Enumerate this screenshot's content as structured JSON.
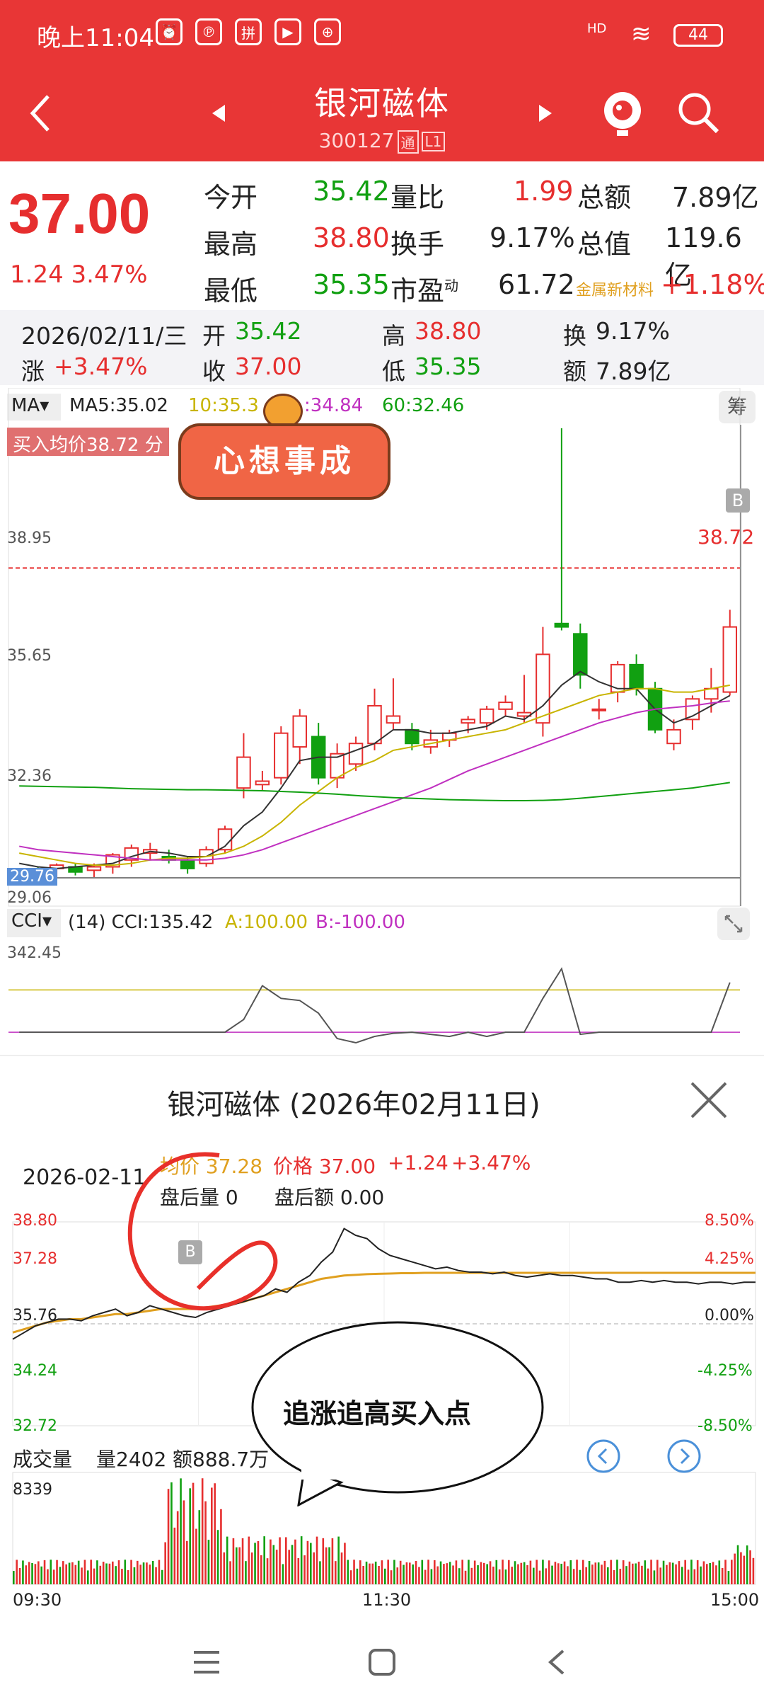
{
  "status": {
    "time": "晚上11:04",
    "network": "HD",
    "battery": "44"
  },
  "header": {
    "title": "银河磁体",
    "code": "300127",
    "tag_tong": "通",
    "tag_l1": "L1"
  },
  "quote": {
    "price": "37.00",
    "change": "1.24",
    "change_pct": "3.47%",
    "open_label": "今开",
    "open": "35.42",
    "high_label": "最高",
    "high": "38.80",
    "low_label": "最低",
    "low": "35.35",
    "volratio_label": "量比",
    "volratio": "1.99",
    "turnover_label": "换手",
    "turnover": "9.17%",
    "pe_label": "市盈",
    "pe_sup": "动",
    "pe": "61.72",
    "amount_label": "总额",
    "amount": "7.89亿",
    "mktcap_label": "总值",
    "mktcap": "119.6亿",
    "sector_name": "金属新材料",
    "sector_pct": "+1.18%"
  },
  "day": {
    "date": "2026/02/11/三",
    "open_label": "开",
    "open": "35.42",
    "high_label": "高",
    "high": "38.80",
    "turn_label": "换",
    "turn": "9.17%",
    "chg_label": "涨",
    "chg": "+3.47%",
    "close_label": "收",
    "close": "37.00",
    "low_label": "低",
    "low": "35.35",
    "amt_label": "额",
    "amt": "7.89亿"
  },
  "kline": {
    "ma_label": "MA",
    "ma5": "MA5:35.02",
    "ma10": "10:35.3",
    "ma20": ":34.84",
    "ma60": "60:32.46",
    "chip_btn": "筹",
    "buy_avg": "买入均价38.72 分",
    "sticker": "心想事成",
    "ylabels": [
      "38.95",
      "35.65",
      "32.36",
      "29.76",
      "29.06"
    ],
    "price_tag": "38.72",
    "b_marker": "B",
    "cci_label": "CCI",
    "cci_text": "(14) CCI:135.42",
    "cci_a": "A:100.00",
    "cci_b": "B:-100.00",
    "cci_top": "342.45"
  },
  "popup": {
    "title": "银河磁体 (2026年02月11日)",
    "date": "2026-02-11",
    "avg_price": "均价 37.28",
    "price": "价格 37.00",
    "chg": "+1.24",
    "chg_pct": "+3.47%",
    "after_vol": "盘后量  0",
    "after_amt": "盘后额  0.00",
    "left_axis": [
      "38.80",
      "37.28",
      "35.76",
      "34.24",
      "32.72"
    ],
    "right_axis": [
      "8.50%",
      "4.25%",
      "0.00%",
      "-4.25%",
      "-8.50%"
    ],
    "vol_label": "成交量",
    "vol": "量2402",
    "amt": "额888.7万",
    "vol_max": "8339",
    "times": [
      "09:30",
      "11:30",
      "15:00"
    ],
    "comment": "追涨追高买入点",
    "b_marker": "B"
  },
  "kline_chart_data": {
    "type": "candlestick",
    "candles": [
      [
        29.7,
        29.95,
        29.5,
        29.9
      ],
      [
        29.9,
        30.0,
        29.7,
        29.85
      ],
      [
        29.95,
        30.1,
        29.7,
        30.05
      ],
      [
        30.0,
        30.1,
        29.75,
        29.85
      ],
      [
        29.9,
        30.1,
        29.7,
        30.0
      ],
      [
        30.0,
        30.4,
        29.8,
        30.35
      ],
      [
        30.2,
        30.65,
        30.0,
        30.55
      ],
      [
        30.4,
        30.7,
        30.2,
        30.5
      ],
      [
        30.3,
        30.5,
        30.1,
        30.2
      ],
      [
        30.2,
        30.3,
        29.8,
        29.95
      ],
      [
        30.1,
        30.6,
        30.0,
        30.5
      ],
      [
        30.5,
        31.2,
        30.4,
        31.1
      ],
      [
        32.3,
        33.9,
        32.0,
        33.2
      ],
      [
        32.4,
        32.8,
        32.2,
        32.5
      ],
      [
        32.6,
        34.1,
        32.4,
        33.9
      ],
      [
        33.5,
        34.6,
        33.0,
        34.4
      ],
      [
        33.8,
        34.2,
        32.4,
        32.6
      ],
      [
        32.6,
        33.6,
        32.3,
        33.3
      ],
      [
        33.0,
        33.8,
        32.8,
        33.6
      ],
      [
        33.6,
        35.2,
        33.4,
        34.7
      ],
      [
        34.2,
        35.5,
        34.0,
        34.4
      ],
      [
        34.0,
        34.2,
        33.4,
        33.6
      ],
      [
        33.5,
        34.0,
        33.3,
        33.7
      ],
      [
        33.7,
        34.0,
        33.5,
        33.9
      ],
      [
        34.2,
        34.4,
        33.9,
        34.3
      ],
      [
        34.2,
        34.7,
        34.0,
        34.6
      ],
      [
        34.6,
        35.0,
        34.4,
        34.8
      ],
      [
        34.4,
        35.6,
        34.2,
        34.5
      ],
      [
        34.2,
        37.0,
        33.8,
        36.2
      ],
      [
        37.1,
        42.8,
        36.9,
        37.0
      ],
      [
        36.8,
        37.1,
        35.2,
        35.6
      ],
      [
        34.6,
        34.9,
        34.3,
        34.6
      ],
      [
        35.1,
        36.0,
        34.8,
        35.9
      ],
      [
        35.9,
        36.2,
        35.0,
        35.2
      ],
      [
        35.2,
        35.4,
        33.9,
        34.0
      ],
      [
        33.6,
        34.3,
        33.4,
        34.0
      ],
      [
        34.3,
        35.0,
        34.0,
        34.9
      ],
      [
        34.9,
        35.8,
        34.5,
        35.2
      ],
      [
        35.1,
        37.5,
        35.0,
        37.0
      ]
    ],
    "ma5": [
      30.1,
      30.0,
      29.95,
      30.0,
      30.05,
      30.1,
      30.3,
      30.45,
      30.4,
      30.3,
      30.3,
      30.6,
      31.2,
      31.6,
      32.3,
      33.1,
      33.2,
      33.2,
      33.4,
      33.6,
      34.0,
      34.0,
      33.9,
      33.9,
      34.0,
      34.1,
      34.4,
      34.3,
      34.7,
      35.3,
      35.7,
      35.4,
      35.2,
      35.2,
      34.6,
      34.2,
      34.4,
      34.7,
      35.0
    ],
    "ma10": [
      30.4,
      30.3,
      30.2,
      30.1,
      30.05,
      30.05,
      30.1,
      30.2,
      30.25,
      30.25,
      30.3,
      30.4,
      30.6,
      30.9,
      31.3,
      31.8,
      32.2,
      32.6,
      32.9,
      33.1,
      33.4,
      33.5,
      33.6,
      33.7,
      33.8,
      33.9,
      34.0,
      34.2,
      34.4,
      34.6,
      34.8,
      35.0,
      35.1,
      35.2,
      35.2,
      35.1,
      35.1,
      35.2,
      35.3
    ],
    "ma20": [
      30.6,
      30.5,
      30.45,
      30.4,
      30.35,
      30.3,
      30.25,
      30.2,
      30.2,
      30.2,
      30.2,
      30.25,
      30.35,
      30.5,
      30.7,
      30.9,
      31.1,
      31.3,
      31.5,
      31.7,
      31.9,
      32.1,
      32.3,
      32.55,
      32.8,
      33.0,
      33.2,
      33.4,
      33.6,
      33.8,
      34.0,
      34.2,
      34.35,
      34.5,
      34.6,
      34.65,
      34.7,
      34.78,
      34.84
    ],
    "ma60": [
      32.36,
      32.35,
      32.34,
      32.33,
      32.32,
      32.3,
      32.28,
      32.27,
      32.26,
      32.25,
      32.25,
      32.24,
      32.23,
      32.22,
      32.2,
      32.18,
      32.15,
      32.12,
      32.08,
      32.05,
      32.02,
      32.0,
      31.98,
      31.96,
      31.95,
      31.94,
      31.93,
      31.93,
      31.94,
      31.96,
      32.0,
      32.05,
      32.1,
      32.15,
      32.2,
      32.25,
      32.3,
      32.38,
      32.46
    ],
    "cci": [
      -100,
      -100,
      -100,
      -100,
      -100,
      -100,
      -100,
      -100,
      -100,
      -100,
      -100,
      -100,
      -40,
      120,
      60,
      50,
      -10,
      -130,
      -150,
      -120,
      -105,
      -100,
      -110,
      -120,
      -100,
      -120,
      -100,
      -100,
      60,
      200,
      -110,
      -100,
      -100,
      -100,
      -100,
      -100,
      -100,
      -100,
      135.42
    ],
    "ylim": [
      29.06,
      42.9
    ]
  },
  "intraday_chart_data": {
    "type": "line",
    "price": [
      35.3,
      35.5,
      35.7,
      35.8,
      35.9,
      35.9,
      35.85,
      36.0,
      36.1,
      36.2,
      36.0,
      36.1,
      36.3,
      36.2,
      36.1,
      36.0,
      35.95,
      36.1,
      36.2,
      36.3,
      36.4,
      36.5,
      36.6,
      36.8,
      36.7,
      37.0,
      37.2,
      37.6,
      37.9,
      38.6,
      38.4,
      38.3,
      38.0,
      37.8,
      37.7,
      37.6,
      37.5,
      37.4,
      37.45,
      37.35,
      37.3,
      37.3,
      37.25,
      37.3,
      37.2,
      37.15,
      37.2,
      37.25,
      37.2,
      37.2,
      37.15,
      37.1,
      37.1,
      37.0,
      37.0,
      37.05,
      37.0,
      37.05,
      37.0,
      37.0,
      36.95,
      37.0,
      37.0,
      36.95,
      37.0,
      37.0
    ],
    "avg": [
      35.5,
      35.6,
      35.7,
      35.8,
      35.85,
      35.9,
      35.9,
      35.95,
      36.0,
      36.05,
      36.05,
      36.1,
      36.15,
      36.2,
      36.2,
      36.2,
      36.2,
      36.25,
      36.3,
      36.35,
      36.4,
      36.5,
      36.6,
      36.7,
      36.8,
      36.9,
      37.0,
      37.1,
      37.15,
      37.2,
      37.22,
      37.24,
      37.25,
      37.26,
      37.27,
      37.27,
      37.28,
      37.28,
      37.28,
      37.28,
      37.28,
      37.28,
      37.28,
      37.28,
      37.28,
      37.28,
      37.28,
      37.28,
      37.28,
      37.28,
      37.28,
      37.28,
      37.28,
      37.28,
      37.28,
      37.28,
      37.28,
      37.28,
      37.28,
      37.28,
      37.28,
      37.28,
      37.28,
      37.28,
      37.28,
      37.28
    ],
    "ylim": [
      32.72,
      38.8
    ]
  }
}
